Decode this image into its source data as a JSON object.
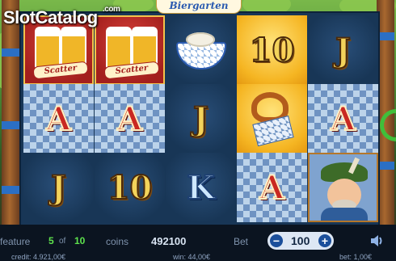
{
  "header": {
    "game_title": "Biergarten",
    "watermark_main": "SlotCatalog",
    "watermark_suffix": ".com"
  },
  "reels": [
    [
      "scatter",
      "A",
      "J"
    ],
    [
      "scatter",
      "A",
      "10"
    ],
    [
      "weisswurst",
      "J",
      "K"
    ],
    [
      "10",
      "pretzel",
      "A"
    ],
    [
      "J",
      "A",
      "bavarian-man"
    ]
  ],
  "labels": {
    "scatter": "Scatter",
    "A": "A",
    "J": "J",
    "K": "K",
    "10": "10"
  },
  "status": {
    "feature_label": "feature",
    "feature_current": "5",
    "feature_of": "of",
    "feature_total": "10",
    "coins_label": "coins",
    "coins_value": "492100",
    "bet_label": "Bet",
    "bet_value": "100",
    "bet_minus": "−",
    "bet_plus": "+",
    "credit_text": "credit: 4.921,00€",
    "win_text": "win: 44,00€",
    "bet_text": "bet: 1,00€"
  },
  "colors": {
    "accent_green": "#5ee24d",
    "panel_blue": "#183656",
    "bet_button_blue": "#1b4f9b"
  },
  "icons": [
    "sound-icon",
    "spin-arrow-icon"
  ]
}
